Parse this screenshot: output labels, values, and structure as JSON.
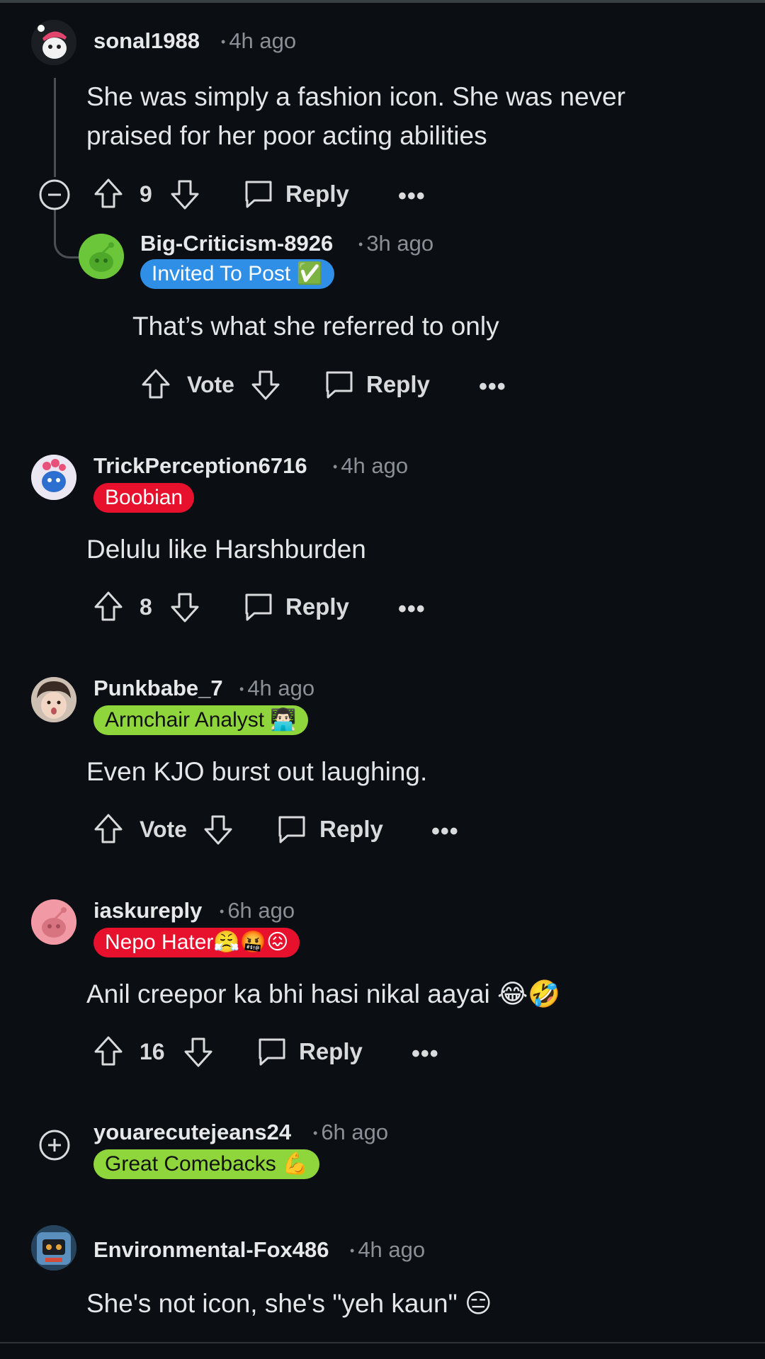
{
  "comments": [
    {
      "username": "sonal1988",
      "time": "4h ago",
      "body": "She was simply a fashion icon. She was never praised for her poor acting abilities",
      "votes": "9"
    },
    {
      "username": "Big-Criticism-8926",
      "time": "3h ago",
      "flair": "Invited To Post ✅",
      "flair_color": "#2f8fe6",
      "body": "That’s what she referred to only",
      "votes": "Vote"
    },
    {
      "username": "TrickPerception6716",
      "time": "4h ago",
      "flair": "Boobian",
      "flair_color": "#e8112d",
      "body": "Delulu like Harshburden",
      "votes": "8"
    },
    {
      "username": "Punkbabe_7",
      "time": "4h ago",
      "flair": "Armchair Analyst 👨🏻‍💻",
      "flair_color": "#8fd63c",
      "body": "Even KJO burst out laughing.",
      "votes": "Vote"
    },
    {
      "username": "iaskureply",
      "time": "6h ago",
      "flair": "Nepo Hater😤🤬😖",
      "flair_color": "#e8112d",
      "body": "Anil creepor ka bhi hasi nikal aayai 😂🤣",
      "votes": "16"
    },
    {
      "username": "youarecutejeans24",
      "time": "6h ago",
      "flair": "Great Comebacks 💪",
      "flair_color": "#8fd63c"
    },
    {
      "username": "Environmental-Fox486",
      "time": "4h ago",
      "body": "She's not icon, she's \"yeh kaun\" 😑"
    }
  ],
  "labels": {
    "reply": "Reply",
    "more": "•••"
  },
  "icons": [
    "upvote-icon",
    "downvote-icon",
    "reply-bubble-icon",
    "collapse-icon",
    "expand-icon"
  ]
}
